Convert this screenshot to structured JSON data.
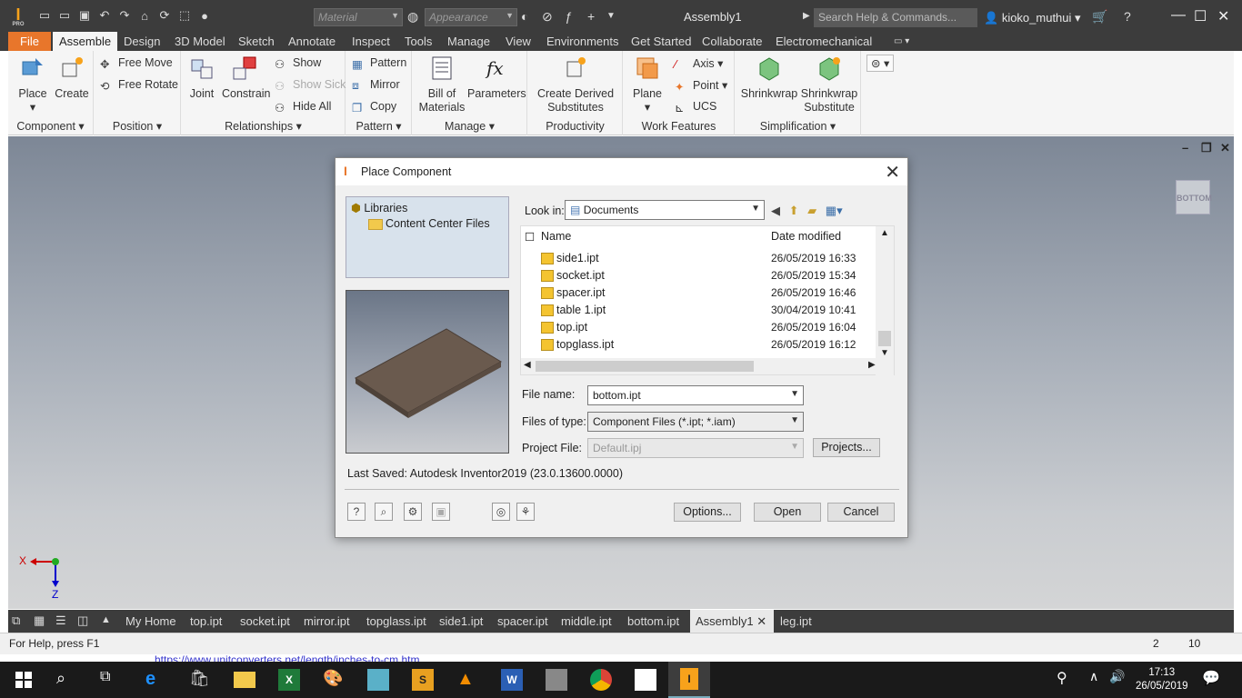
{
  "app": {
    "title": "Assembly1",
    "material_placeholder": "Material",
    "appearance_placeholder": "Appearance",
    "search_placeholder": "Search Help & Commands...",
    "user": "kioko_muthui",
    "logo_sub": "PRO"
  },
  "tabs": [
    "File",
    "Assemble",
    "Design",
    "3D Model",
    "Sketch",
    "Annotate",
    "Inspect",
    "Tools",
    "Manage",
    "View",
    "Environments",
    "Get Started",
    "Collaborate",
    "Electromechanical"
  ],
  "ribbon": {
    "component": {
      "label": "Component",
      "place": "Place",
      "create": "Create"
    },
    "position": {
      "label": "Position",
      "free_move": "Free Move",
      "free_rotate": "Free Rotate"
    },
    "relationships": {
      "label": "Relationships",
      "joint": "Joint",
      "constrain": "Constrain",
      "show": "Show",
      "show_sick": "Show Sick",
      "hide_all": "Hide All"
    },
    "pattern": {
      "label": "Pattern",
      "pattern": "Pattern",
      "mirror": "Mirror",
      "copy": "Copy"
    },
    "manage": {
      "label": "Manage",
      "bill": "Bill of",
      "materials": "Materials",
      "parameters": "Parameters"
    },
    "productivity": {
      "label": "Productivity",
      "line1": "Create Derived",
      "line2": "Substitutes"
    },
    "work_features": {
      "label": "Work Features",
      "plane": "Plane",
      "axis": "Axis",
      "point": "Point",
      "ucs": "UCS"
    },
    "simplification": {
      "label": "Simplification",
      "shrinkwrap": "Shrinkwrap",
      "shrinkwrap2": "Shrinkwrap",
      "substitute": "Substitute"
    }
  },
  "viewcube_label": "BOTTOM",
  "axes": {
    "x": "X",
    "z": "Z"
  },
  "dialog": {
    "title": "Place Component",
    "libraries": "Libraries",
    "content_center": "Content Center Files",
    "look_in_label": "Look in:",
    "look_in_value": "Documents",
    "col_name": "Name",
    "col_date": "Date modified",
    "files": [
      {
        "name": "side1.ipt",
        "date": "26/05/2019 16:33"
      },
      {
        "name": "socket.ipt",
        "date": "26/05/2019 15:34"
      },
      {
        "name": "spacer.ipt",
        "date": "26/05/2019 16:46"
      },
      {
        "name": "table 1.ipt",
        "date": "30/04/2019 10:41"
      },
      {
        "name": "top.ipt",
        "date": "26/05/2019 16:04"
      },
      {
        "name": "topglass.ipt",
        "date": "26/05/2019 16:12"
      }
    ],
    "file_name_label": "File name:",
    "file_name_value": "bottom.ipt",
    "file_type_label": "Files of type:",
    "file_type_value": "Component Files (*.ipt; *.iam)",
    "project_label": "Project File:",
    "project_value": "Default.ipj",
    "projects_btn": "Projects...",
    "last_saved": "Last Saved: Autodesk Inventor2019 (23.0.13600.0000)",
    "options_btn": "Options...",
    "open_btn": "Open",
    "cancel_btn": "Cancel"
  },
  "doc_tabs": [
    "My Home",
    "top.ipt",
    "socket.ipt",
    "mirror.ipt",
    "topglass.ipt",
    "side1.ipt",
    "spacer.ipt",
    "middle.ipt",
    "bottom.ipt",
    "Assembly1",
    "leg.ipt"
  ],
  "status": {
    "help": "For Help, press F1",
    "n1": "2",
    "n2": "10"
  },
  "browser_peek": "https://www.unitconverters.net/length/inches-to-cm.htm",
  "clock": {
    "time": "17:13",
    "date": "26/05/2019"
  },
  "colors": {
    "accent": "#e8762b",
    "dark": "#3c3c3c",
    "taskbar": "#1a1a1a"
  }
}
